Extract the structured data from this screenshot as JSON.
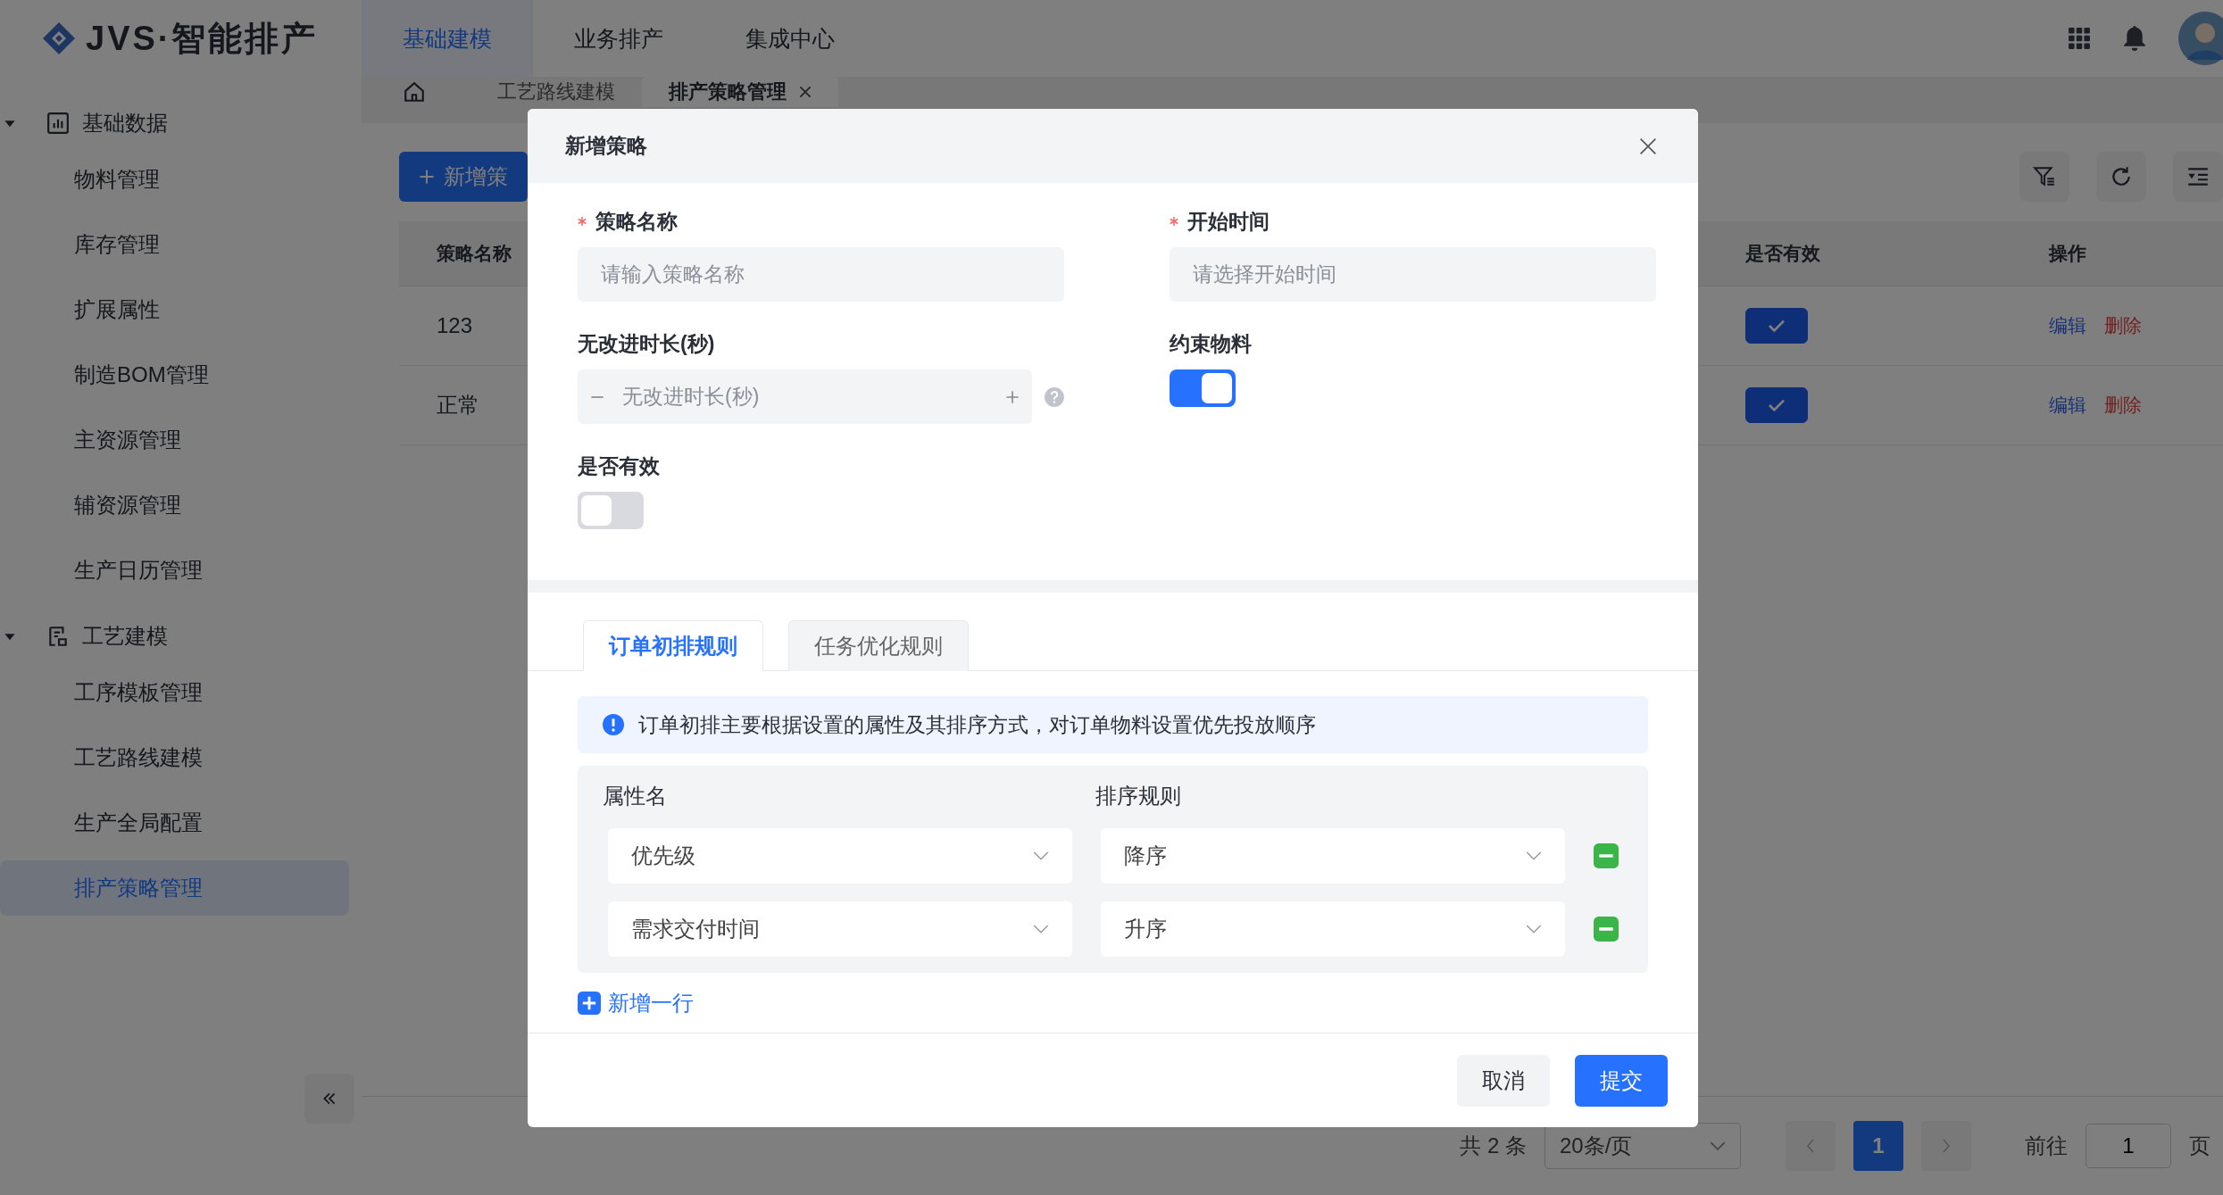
{
  "topbar": {
    "logo": "JVS·智能排产",
    "nav": [
      {
        "label": "基础建模",
        "selected": true
      },
      {
        "label": "业务排产",
        "selected": false
      },
      {
        "label": "集成中心",
        "selected": false
      }
    ]
  },
  "sidebar": {
    "groups": [
      {
        "label": "基础数据",
        "expanded": true,
        "items": [
          {
            "label": "物料管理",
            "selected": false
          },
          {
            "label": "库存管理",
            "selected": false
          },
          {
            "label": "扩展属性",
            "selected": false
          },
          {
            "label": "制造BOM管理",
            "selected": false
          },
          {
            "label": "主资源管理",
            "selected": false
          },
          {
            "label": "辅资源管理",
            "selected": false
          },
          {
            "label": "生产日历管理",
            "selected": false
          }
        ]
      },
      {
        "label": "工艺建模",
        "expanded": true,
        "items": [
          {
            "label": "工序模板管理",
            "selected": false
          },
          {
            "label": "工艺路线建模",
            "selected": false
          },
          {
            "label": "生产全局配置",
            "selected": false
          },
          {
            "label": "排产策略管理",
            "selected": true
          }
        ]
      }
    ]
  },
  "page_tabs": [
    {
      "label": "工艺路线建模",
      "selected": false,
      "closable": false
    },
    {
      "label": "排产策略管理",
      "selected": true,
      "closable": true
    }
  ],
  "toolbar": {
    "add_button": "新增策"
  },
  "table": {
    "columns": [
      "策略名称",
      "是否有效",
      "操作"
    ],
    "rows": [
      {
        "name": "123",
        "valid": true,
        "actions": [
          "编辑",
          "删除"
        ]
      },
      {
        "name": "正常",
        "valid": true,
        "actions": [
          "编辑",
          "删除"
        ]
      }
    ]
  },
  "pagination": {
    "total": "共 2 条",
    "page_size": "20条/页",
    "pages": [
      {
        "label": "1",
        "selected": true
      }
    ],
    "goto_label": "前往",
    "goto_value": "1",
    "page_suffix": "页"
  },
  "dialog": {
    "title": "新增策略",
    "fields": [
      {
        "kind": "input",
        "label": "策略名称",
        "required": true,
        "placeholder": "请输入策略名称"
      },
      {
        "kind": "input",
        "label": "开始时间",
        "required": true,
        "placeholder": "请选择开始时间"
      },
      {
        "kind": "stepper",
        "label": "无改进时长(秒)",
        "required": false,
        "placeholder": "无改进时长(秒)"
      },
      {
        "kind": "switch",
        "label": "约束物料",
        "required": false,
        "on": true
      },
      {
        "kind": "switch",
        "label": "是否有效",
        "required": false,
        "on": false
      }
    ],
    "rule_tabs": [
      {
        "label": "订单初排规则",
        "selected": true
      },
      {
        "label": "任务优化规则",
        "selected": false
      }
    ],
    "info": "订单初排主要根据设置的属性及其排序方式，对订单物料设置优先投放顺序",
    "rule_columns": [
      "属性名",
      "排序规则"
    ],
    "rules": [
      {
        "attribute": "优先级",
        "order": "降序"
      },
      {
        "attribute": "需求交付时间",
        "order": "升序"
      }
    ],
    "add_row": "新增一行",
    "buttons": {
      "cancel": "取消",
      "submit": "提交"
    }
  }
}
